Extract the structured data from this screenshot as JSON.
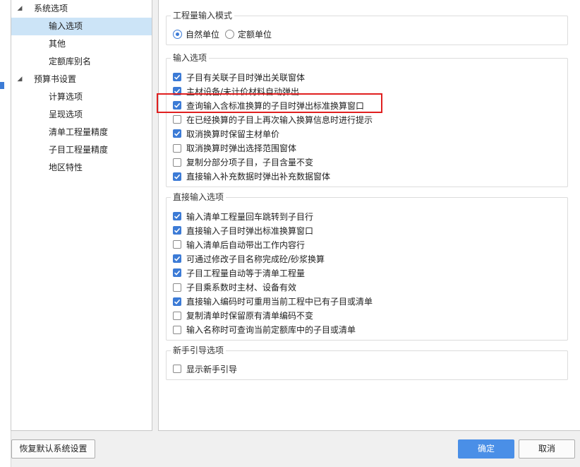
{
  "tree": {
    "items": [
      {
        "label": "系统选项",
        "level": 0,
        "expanded": true,
        "selected": false
      },
      {
        "label": "输入选项",
        "level": 1,
        "selected": true
      },
      {
        "label": "其他",
        "level": 1,
        "selected": false
      },
      {
        "label": "定额库别名",
        "level": 1,
        "selected": false
      },
      {
        "label": "预算书设置",
        "level": 0,
        "expanded": true,
        "selected": false
      },
      {
        "label": "计算选项",
        "level": 1,
        "selected": false
      },
      {
        "label": "呈现选项",
        "level": 1,
        "selected": false
      },
      {
        "label": "清单工程量精度",
        "level": 1,
        "selected": false
      },
      {
        "label": "子目工程量精度",
        "level": 1,
        "selected": false
      },
      {
        "label": "地区特性",
        "level": 1,
        "selected": false
      }
    ]
  },
  "groups": {
    "mode": {
      "title": "工程量输入模式",
      "options": [
        {
          "label": "自然单位",
          "checked": true
        },
        {
          "label": "定额单位",
          "checked": false
        }
      ]
    },
    "input": {
      "title": "输入选项",
      "items": [
        {
          "label": "子目有关联子目时弹出关联窗体",
          "checked": true
        },
        {
          "label": "主材设备/未计价材料自动弹出",
          "checked": true
        },
        {
          "label": "查询输入含标准换算的子目时弹出标准换算窗口",
          "checked": true
        },
        {
          "label": "在已经换算的子目上再次输入换算信息时进行提示",
          "checked": false
        },
        {
          "label": "取消换算时保留主材单价",
          "checked": true
        },
        {
          "label": "取消换算时弹出选择范围窗体",
          "checked": false
        },
        {
          "label": "复制分部分项子目，子目含量不变",
          "checked": false
        },
        {
          "label": "直接输入补充数据时弹出补充数据窗体",
          "checked": true
        }
      ]
    },
    "direct": {
      "title": "直接输入选项",
      "items": [
        {
          "label": "输入清单工程量回车跳转到子目行",
          "checked": true
        },
        {
          "label": "直接输入子目时弹出标准换算窗口",
          "checked": true
        },
        {
          "label": "输入清单后自动带出工作内容行",
          "checked": false
        },
        {
          "label": "可通过修改子目名称完成砼/砂浆换算",
          "checked": true
        },
        {
          "label": "子目工程量自动等于清单工程量",
          "checked": true
        },
        {
          "label": "子目乘系数时主材、设备有效",
          "checked": false
        },
        {
          "label": "直接输入编码时可重用当前工程中已有子目或清单",
          "checked": true
        },
        {
          "label": "复制清单时保留原有清单编码不变",
          "checked": false
        },
        {
          "label": "输入名称时可查询当前定额库中的子目或清单",
          "checked": false
        }
      ]
    },
    "guide": {
      "title": "新手引导选项",
      "items": [
        {
          "label": "显示新手引导",
          "checked": false
        }
      ]
    }
  },
  "footer": {
    "restore_label": "恢复默认系统设置",
    "ok_label": "确定",
    "cancel_label": "取消"
  },
  "colors": {
    "accent": "#3c7bd6",
    "primary_button": "#4a8fe7",
    "selection": "#cce4f7",
    "highlight_box": "#e02020"
  }
}
